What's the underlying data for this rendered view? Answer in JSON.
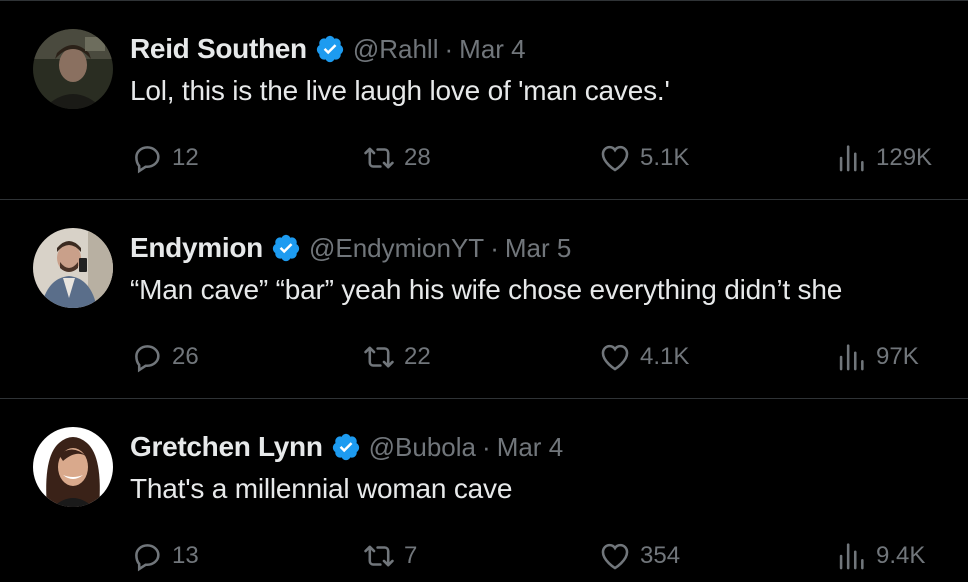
{
  "tweets": [
    {
      "name": "Reid Southen",
      "handle": "@Rahll",
      "separator": "·",
      "date": "Mar 4",
      "text": "Lol, this is the live laugh love of 'man caves.'",
      "replies": "12",
      "retweets": "28",
      "likes": "5.1K",
      "views": "129K",
      "verified": true
    },
    {
      "name": "Endymion",
      "handle": "@EndymionYT",
      "separator": "·",
      "date": "Mar 5",
      "text": "“Man cave” “bar” yeah his wife chose everything didn’t she",
      "replies": "26",
      "retweets": "22",
      "likes": "4.1K",
      "views": "97K",
      "verified": true
    },
    {
      "name": "Gretchen Lynn",
      "handle": "@Bubola",
      "separator": "·",
      "date": "Mar 4",
      "text": "That's a millennial woman cave",
      "replies": "13",
      "retweets": "7",
      "likes": "354",
      "views": "9.4K",
      "verified": true
    }
  ],
  "colors": {
    "background": "#000000",
    "text": "#e7e9ea",
    "secondary": "#71767b",
    "divider": "#2f3336",
    "verified": "#1d9bf0"
  },
  "icons": [
    "reply-icon",
    "retweet-icon",
    "like-icon",
    "views-icon",
    "verified-badge-icon"
  ]
}
